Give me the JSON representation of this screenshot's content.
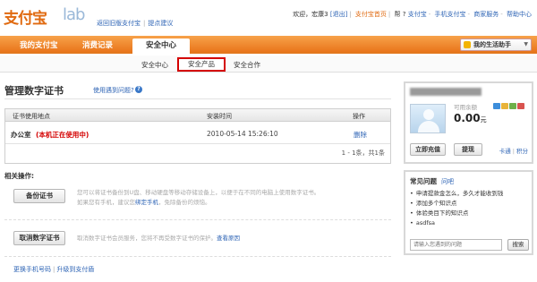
{
  "header": {
    "logo_text": "支付宝",
    "lab_text": "lab",
    "left_links": [
      "返回旧版支付宝",
      "提点建议"
    ],
    "welcome": "欢迎，",
    "user": "宏康3",
    "logout": "[退出]",
    "right_links": [
      "支付宝首页",
      "帮 ?",
      "支付宝",
      "手机支付宝",
      "商家服务",
      "帮助中心"
    ]
  },
  "nav": {
    "tabs": [
      "我的支付宝",
      "消费记录",
      "安全中心"
    ],
    "active": "安全中心",
    "helper": "我的生活助手"
  },
  "subnav": {
    "tabs": [
      "安全中心",
      "安全产品",
      "安全合作"
    ],
    "active": "安全产品"
  },
  "main": {
    "title": "管理数字证书",
    "help_link": "使用遇到问题?",
    "help_icon": "question-icon",
    "table": {
      "headers": [
        "证书使用地点",
        "安装时间",
        "操作"
      ],
      "rows": [
        {
          "site": "办公室",
          "status": "(本机正在使用中)",
          "time": "2010-05-14 15:26:10",
          "action": "删除"
        }
      ],
      "footer": "1 - 1条，共1条"
    },
    "related_title": "相关操作:",
    "backup_button": "备份证书",
    "backup_desc_1": "您可以将证书备份到U盘、移动硬盘等移动存储设备上，以便于在不同的电脑上使用数字证书。",
    "backup_desc_2a": "如果您有手机，建议您",
    "backup_desc_link": "绑定手机",
    "backup_desc_2b": "，免除备份的烦恼。",
    "cancel_button": "取消数字证书",
    "cancel_desc": "取消数字证书会员服务，您将不再受数字证书的保护。",
    "cancel_link": "查看原因",
    "bottom_links": [
      "更换手机号码",
      "升级到支付盾"
    ]
  },
  "account": {
    "balance_label": "可用余额",
    "balance": "0.00",
    "unit": "元",
    "recharge": "立即充值",
    "withdraw": "提现",
    "links": [
      "卡通",
      "积分"
    ],
    "icon_colors": [
      "#3d8edb",
      "#e8b33a",
      "#6fb04a",
      "#d9534f"
    ]
  },
  "faq": {
    "title": "常见问题",
    "more": "问吧",
    "items": [
      "申请提款金怎么，多久才能收到钱",
      "添加多个知识点",
      "体验类目下的知识点",
      "asdfsa"
    ],
    "placeholder": "请输入您遇到的问题",
    "search": "搜索"
  }
}
